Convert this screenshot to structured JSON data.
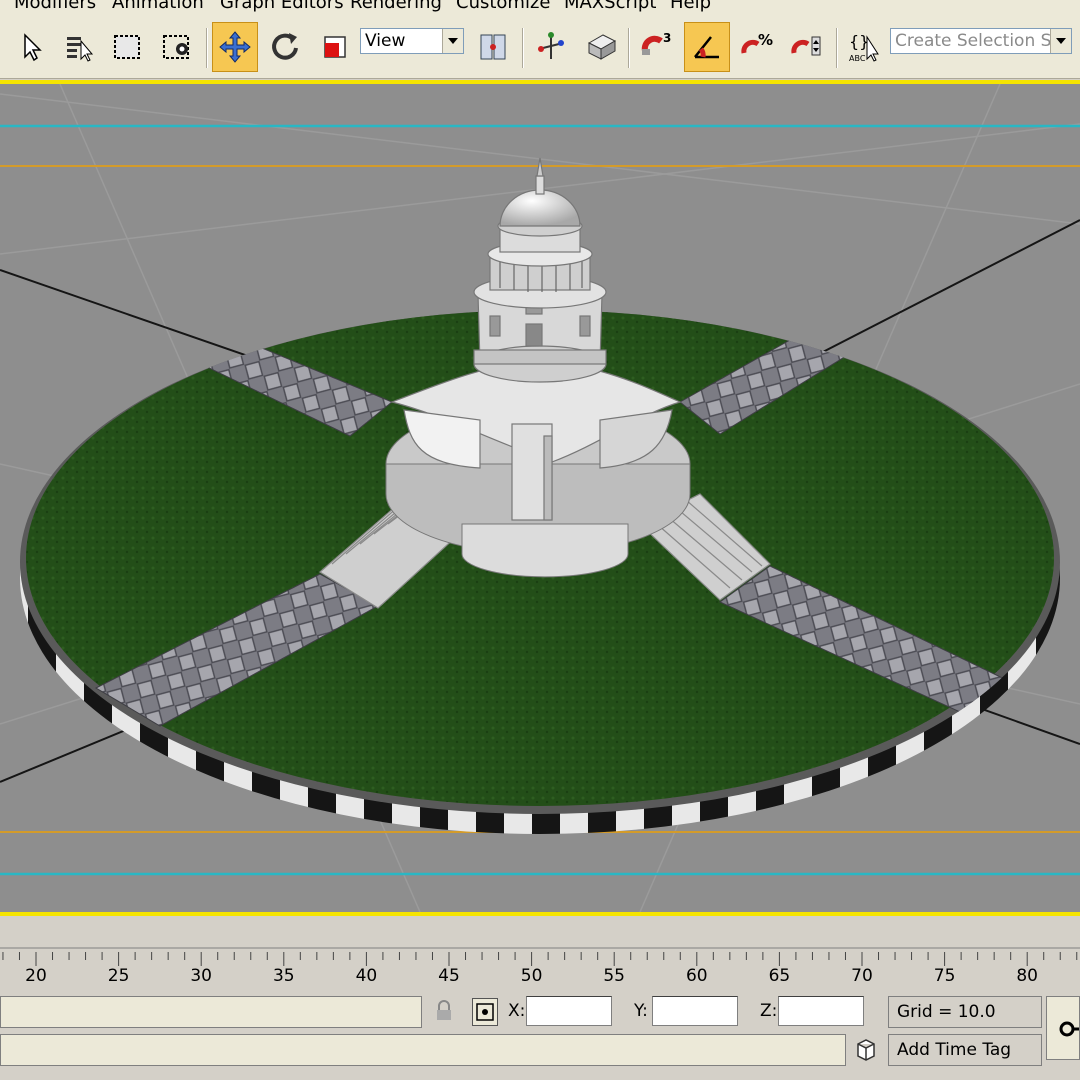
{
  "menu": {
    "items": [
      "Modifiers",
      "Animation",
      "Graph Editors",
      "Rendering",
      "Customize",
      "MAXScript",
      "Help"
    ]
  },
  "toolbar": {
    "view_dropdown": "View",
    "selection_set_placeholder": "Create Selection Set",
    "active_tools": [
      "select-and-move",
      "angle-snap"
    ]
  },
  "timeline": {
    "ticks": [
      "20",
      "25",
      "30",
      "35",
      "40",
      "45",
      "50",
      "55",
      "60",
      "65",
      "70",
      "75",
      "80"
    ]
  },
  "status": {
    "x_label": "X:",
    "y_label": "Y:",
    "z_label": "Z:",
    "x_value": "",
    "y_value": "",
    "z_value": "",
    "grid": "Grid = 10.0",
    "add_time_tag": "Add Time Tag"
  },
  "colors": {
    "active_tool": "#f6c752",
    "viewport_border": "#f5e400",
    "viewport_bg": "#8e8e8e",
    "grass": "#1f4a16",
    "guide_cyan": "#29b7c4",
    "guide_orange": "#d39b2a"
  }
}
